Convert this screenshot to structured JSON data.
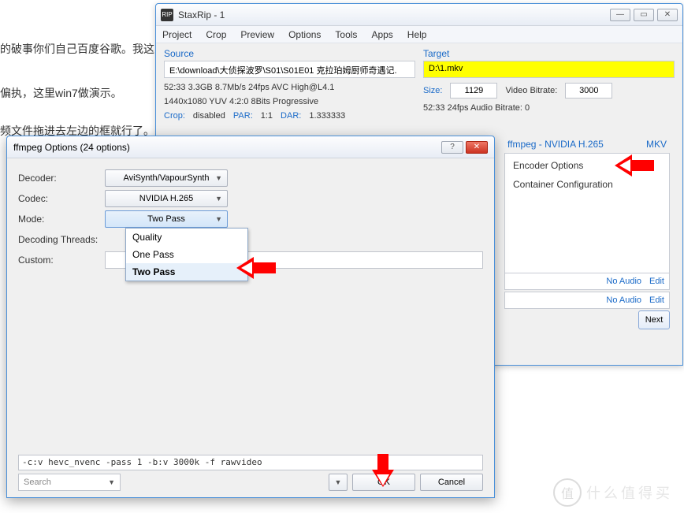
{
  "bg": {
    "line1": "的破事你们自己百度谷歌。我这",
    "line2": "偏执，这里win7做演示。",
    "line3": "频文件拖进去左边的框就行了。"
  },
  "main": {
    "title": "StaxRip - 1",
    "icon_text": "RIP",
    "menu": [
      "Project",
      "Crop",
      "Preview",
      "Options",
      "Tools",
      "Apps",
      "Help"
    ],
    "source": {
      "label": "Source",
      "path": "E:\\download\\大侦探波罗\\S01\\S01E01 克拉珀姆厨师奇遇记.",
      "info1": "52:33   3.3GB   8.7Mb/s   24fps   AVC   High@L4.1",
      "info2": "1440x1080   YUV   4:2:0   8Bits   Progressive",
      "crop_label": "Crop:",
      "crop_value": "disabled",
      "par_label": "PAR:",
      "par_value": "1:1",
      "dar_label": "DAR:",
      "dar_value": "1.333333"
    },
    "target": {
      "label": "Target",
      "path": "D:\\1.mkv",
      "size_label": "Size:",
      "size_value": "1129",
      "bitrate_label": "Video Bitrate:",
      "bitrate_value": "3000",
      "info": "52:33   24fps   Audio Bitrate: 0"
    },
    "panel": {
      "codec": "ffmpeg - NVIDIA H.265",
      "container": "MKV",
      "enc_options": "Encoder Options",
      "cont_config": "Container Configuration"
    },
    "audio": {
      "none": "No Audio",
      "edit": "Edit"
    },
    "next": "Next"
  },
  "dialog": {
    "title": "ffmpeg Options (24 options)",
    "labels": {
      "decoder": "Decoder:",
      "codec": "Codec:",
      "mode": "Mode:",
      "threads": "Decoding Threads:",
      "custom": "Custom:"
    },
    "values": {
      "decoder": "AviSynth/VapourSynth",
      "codec": "NVIDIA H.265",
      "mode": "Two Pass"
    },
    "options": [
      "Quality",
      "One Pass",
      "Two Pass"
    ],
    "cmdline": "-c:v hevc_nvenc -pass 1 -b:v 3000k -f rawvideo",
    "search_placeholder": "Search",
    "ok": "OK",
    "cancel": "Cancel"
  },
  "watermark": "什么值得买"
}
